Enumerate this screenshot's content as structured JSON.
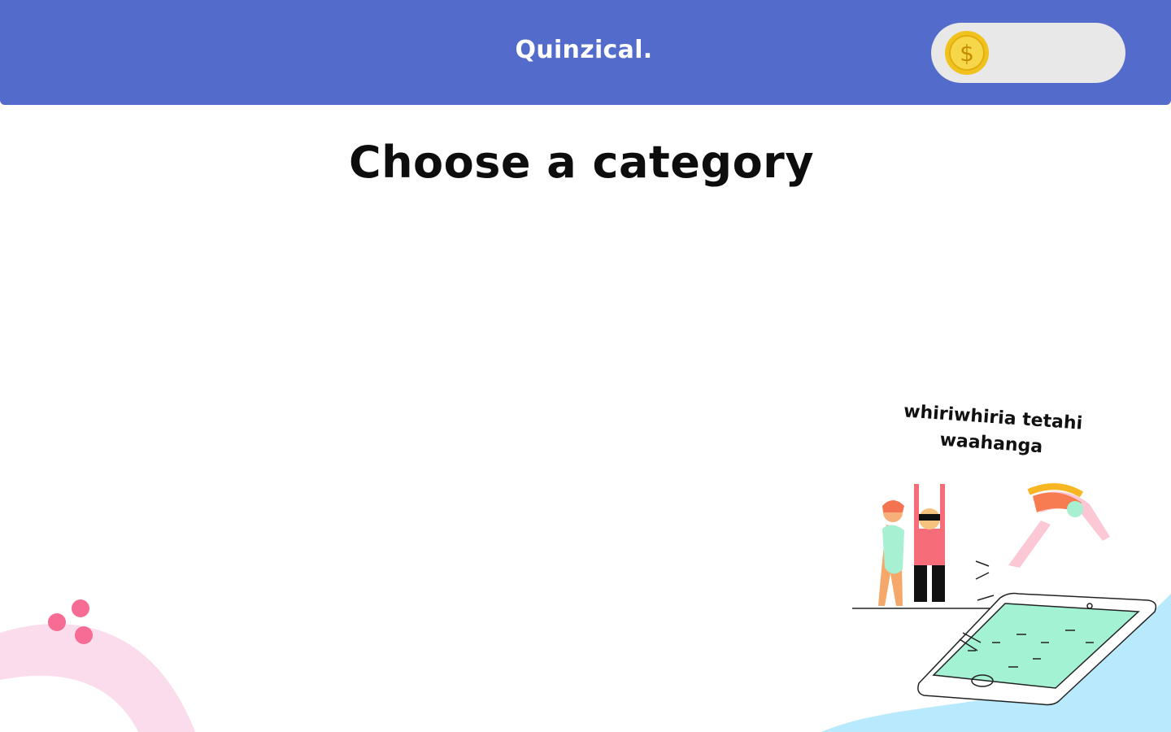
{
  "header": {
    "brand": "Quinzical.",
    "coin_icon": "dollar-coin-icon",
    "coin_balance": ""
  },
  "main": {
    "title": "Choose a category"
  },
  "illustration": {
    "caption": "whiriwhiria tetahi waahanga"
  },
  "colors": {
    "header_bg": "#536ccb",
    "coin_pill_bg": "#e8e8e8",
    "coin_gold": "#f5c518",
    "pink_arc": "#fbdced",
    "pink_dots": "#f66c94",
    "water_blue": "#b9e9fc",
    "pool_green": "#a3f2d4"
  }
}
